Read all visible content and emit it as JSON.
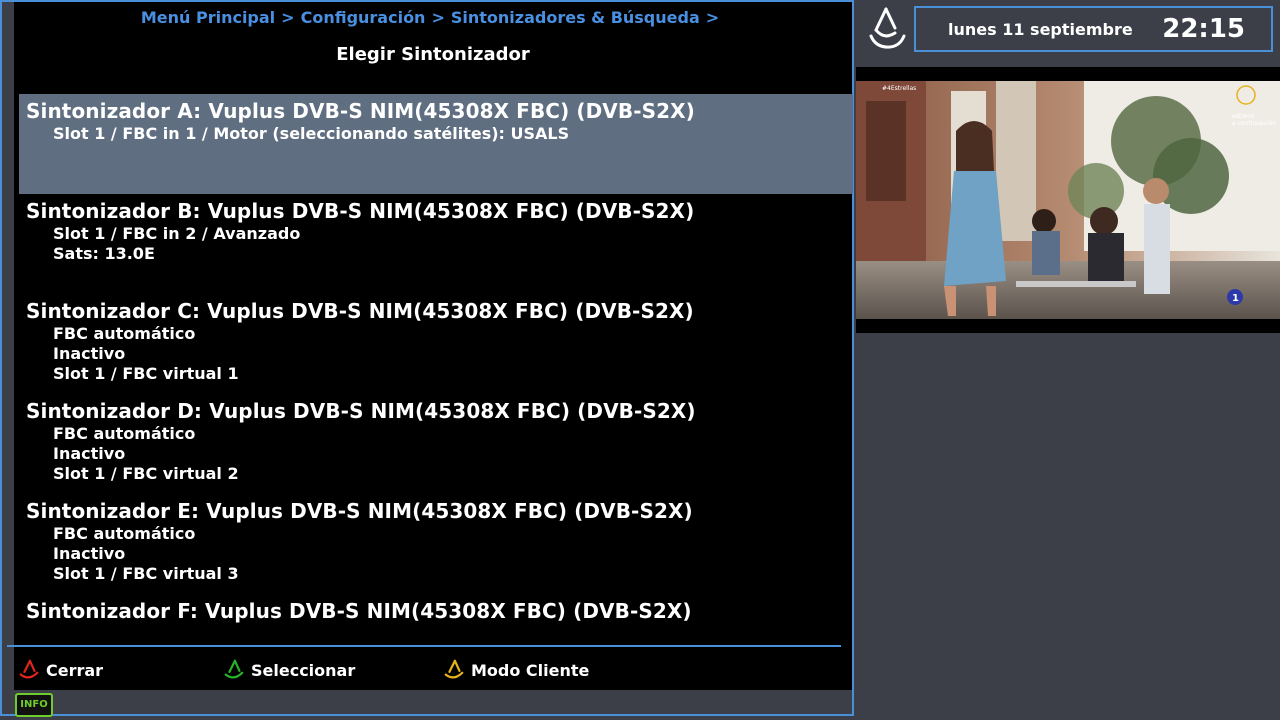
{
  "breadcrumb": {
    "items": [
      "Menú Principal",
      "Configuración",
      "Sintonizadores & Búsqueda"
    ],
    "separator": ">"
  },
  "page_title": "Elegir Sintonizador",
  "tuners": [
    {
      "title": "Sintonizador A: Vuplus DVB-S NIM(45308X FBC) (DVB-S2X)",
      "lines": [
        "Slot 1 / FBC in 1 / Motor (seleccionando satélites): USALS"
      ],
      "selected": true
    },
    {
      "title": "Sintonizador B: Vuplus DVB-S NIM(45308X FBC) (DVB-S2X)",
      "lines": [
        "Slot 1 / FBC in 2 / Avanzado",
        "Sats: 13.0E"
      ]
    },
    {
      "title": "Sintonizador C: Vuplus DVB-S NIM(45308X FBC) (DVB-S2X)",
      "lines": [
        "FBC automático",
        "Inactivo",
        "Slot 1 / FBC virtual 1"
      ]
    },
    {
      "title": "Sintonizador D: Vuplus DVB-S NIM(45308X FBC) (DVB-S2X)",
      "lines": [
        "FBC automático",
        "Inactivo",
        "Slot 1 / FBC virtual 2"
      ]
    },
    {
      "title": "Sintonizador E: Vuplus DVB-S NIM(45308X FBC) (DVB-S2X)",
      "lines": [
        "FBC automático",
        "Inactivo",
        "Slot 1 / FBC virtual 3"
      ]
    },
    {
      "title": "Sintonizador F: Vuplus DVB-S NIM(45308X FBC) (DVB-S2X)",
      "lines": []
    }
  ],
  "buttons": {
    "red": {
      "label": "Cerrar",
      "color": "#e0261c"
    },
    "green": {
      "label": "Seleccionar",
      "color": "#28b32a"
    },
    "yellow": {
      "label": "Modo Cliente",
      "color": "#e8b21c"
    }
  },
  "info_label": "INFO",
  "clock": {
    "date": "lunes 11 septiembre",
    "time": "22:15"
  },
  "video": {
    "channel_tag": "#4Estrellas",
    "overlay_top_right": [
      "estreno",
      "a continuación"
    ],
    "channel_logo": "1"
  },
  "colors": {
    "accent": "#4a90d9",
    "breadcrumb": "#4a90e2",
    "selection": "#5f6e80",
    "background": "#3c3f48"
  }
}
